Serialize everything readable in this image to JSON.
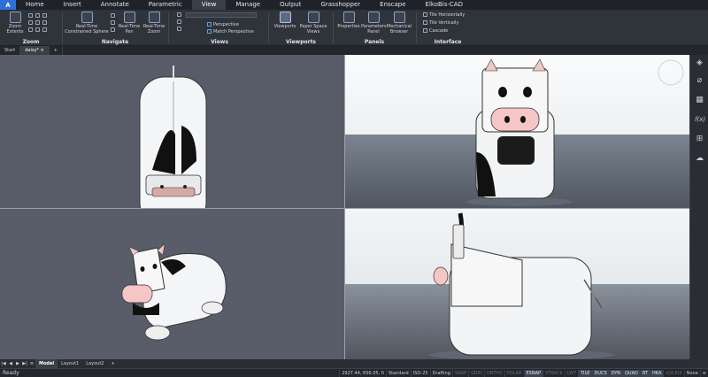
{
  "menu": {
    "tabs": [
      "Home",
      "Insert",
      "Annotate",
      "Parametric",
      "View",
      "Manage",
      "Output",
      "Grasshopper",
      "Enscape",
      "ElkoBis-CAD"
    ],
    "active": "View"
  },
  "ribbon": {
    "zoom": {
      "extents_line1": "Zoom",
      "extents_line2": "Extents",
      "label": "Zoom"
    },
    "navigate": {
      "rt_line1": "Real-Time",
      "rt_line2": "Constrained Sphere",
      "pan_line1": "Real-Time",
      "pan_line2": "Pan",
      "zoom_line1": "Real-Time",
      "zoom_line2": "Zoom",
      "label": "Navigate"
    },
    "views": {
      "perspective": "Perspective",
      "match": "Match Perspective",
      "label": "Views"
    },
    "viewports": {
      "viewports": "Viewports",
      "psv_line1": "Paper Space",
      "psv_line2": "Views",
      "label": "Viewports"
    },
    "panels": {
      "properties": "Properties",
      "params_line1": "Parameters",
      "params_line2": "Panel",
      "mech_line1": "Mechanical",
      "mech_line2": "Browser",
      "label": "Panels"
    },
    "interface": {
      "tile_h": "Tile Horizontally",
      "tile_v": "Tile Vertically",
      "cascade": "Cascade",
      "label": "Interface"
    }
  },
  "doc_tabs": {
    "start": "Start",
    "active": "daisy*",
    "add": "+"
  },
  "layout_tabs": {
    "model": "Model",
    "layout1": "Layout1",
    "layout2": "Layout2",
    "add": "+"
  },
  "status": {
    "ready": "Ready",
    "coords": "2927.44, 656.05, 0",
    "style1": "Standard",
    "style2": "ISO-25",
    "workspace": "Drafting",
    "toggles": [
      {
        "label": "SNAP",
        "state": "off"
      },
      {
        "label": "GRID",
        "state": "off"
      },
      {
        "label": "ORTHO",
        "state": "off"
      },
      {
        "label": "POLAR",
        "state": "off"
      },
      {
        "label": "ESNAP",
        "state": "on"
      },
      {
        "label": "STRACK",
        "state": "off"
      },
      {
        "label": "LWT",
        "state": "off"
      },
      {
        "label": "TILE",
        "state": "on"
      },
      {
        "label": "DUCS",
        "state": "on"
      },
      {
        "label": "DYN",
        "state": "on"
      },
      {
        "label": "QUAD",
        "state": "on"
      },
      {
        "label": "RT",
        "state": "on"
      },
      {
        "label": "HKA",
        "state": "on"
      },
      {
        "label": "LOCKUI",
        "state": "off"
      },
      {
        "label": "None",
        "state": "normal"
      }
    ]
  },
  "sidebar_icons": [
    "layers-icon",
    "attach-icon",
    "grid-panel-icon",
    "function-icon",
    "hierarchy-icon",
    "cloud-icon"
  ],
  "colors": {
    "accent": "#2e6fd9",
    "ribbon_bg": "#2f333a",
    "viewport_dark": "#585b68"
  }
}
